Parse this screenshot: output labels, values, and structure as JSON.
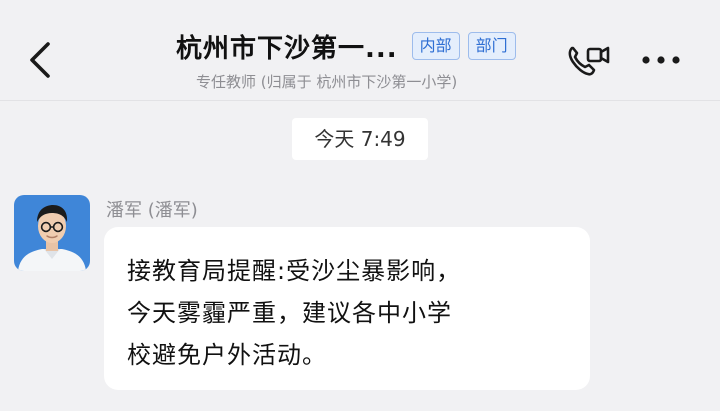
{
  "header": {
    "back_icon": "chevron-left-icon",
    "title": "杭州市下沙第一...",
    "tags": [
      "内部",
      "部门"
    ],
    "subtitle": "专任教师 (归属于 杭州市下沙第一小学)",
    "call_icon": "video-phone-icon",
    "more_icon": "more-dots-icon"
  },
  "chat": {
    "timestamp": "今天 7:49",
    "messages": [
      {
        "sender": "潘军 (潘军)",
        "avatar": "avatar-photo",
        "text": "接教育局提醒:受沙尘暴影响，\n今天雾霾严重，建议各中小学\n校避免户外活动。"
      }
    ]
  },
  "colors": {
    "background": "#f1f1f3",
    "tag_text": "#2f6fd3",
    "tag_bg": "#e4eefc",
    "bubble": "#ffffff",
    "avatar_bg": "#3f86d8"
  }
}
